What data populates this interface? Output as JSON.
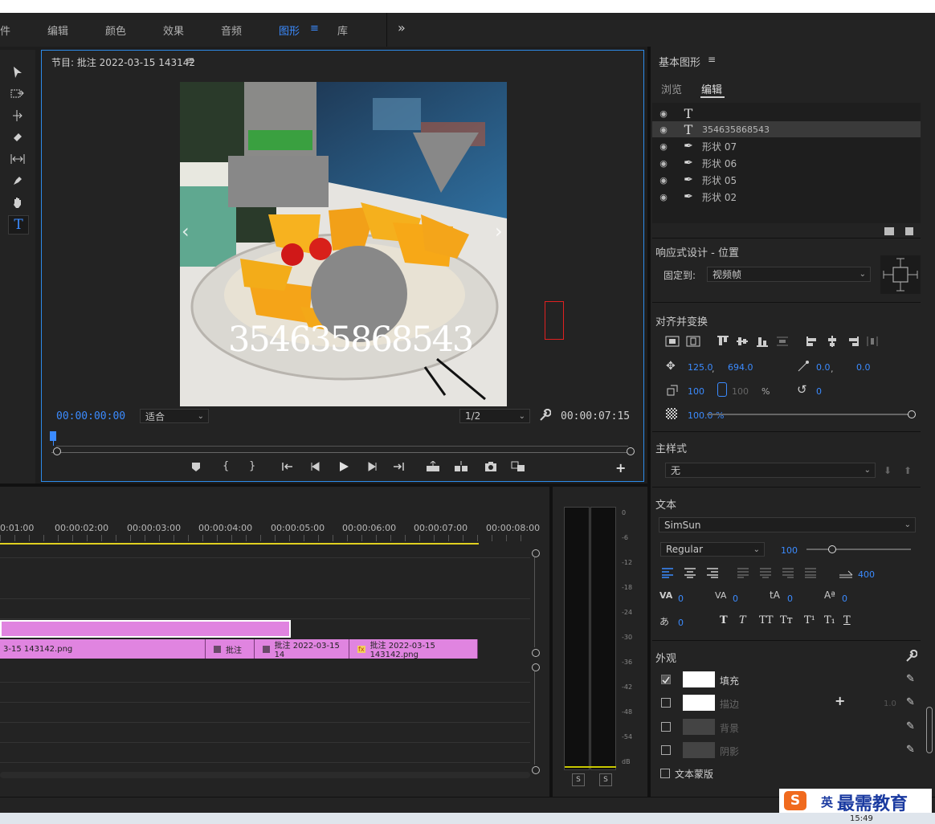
{
  "workspace_tabs": [
    {
      "label": "件"
    },
    {
      "label": "编辑"
    },
    {
      "label": "颜色"
    },
    {
      "label": "效果"
    },
    {
      "label": "音频"
    },
    {
      "label": "图形"
    },
    {
      "label": "库"
    }
  ],
  "workspace_menu_icon": "≡",
  "workspace_more": "»",
  "program_monitor": {
    "title": "节目: 批注 2022-03-15 143142",
    "menu_icon": "≡",
    "overlay_text": "354635868543",
    "timecode_current": "00:00:00:00",
    "zoom_select": "适合",
    "resolution_select": "1/2",
    "timecode_duration": "00:00:07:15",
    "prev_arrow": "‹",
    "next_arrow": "›"
  },
  "timeline": {
    "ruler_labels": [
      "0:01:00",
      "00:00:02:00",
      "00:00:03:00",
      "00:00:04:00",
      "00:00:05:00",
      "00:00:06:00",
      "00:00:07:00",
      "00:00:08:00"
    ],
    "clips": [
      {
        "label": "3-15 143142.png"
      },
      {
        "label": "批注"
      },
      {
        "label": "批注 2022-03-15 14"
      },
      {
        "label": "批注 2022-03-15 143142.png"
      }
    ]
  },
  "audio_meter": {
    "scale": [
      "0",
      "-6",
      "-12",
      "-18",
      "-24",
      "-30",
      "-36",
      "-42",
      "-48",
      "-54",
      "dB"
    ],
    "solo_labels": [
      "S",
      "S"
    ]
  },
  "essential_graphics": {
    "title": "基本图形",
    "menu_icon": "≡",
    "tabs": [
      "浏览",
      "编辑"
    ],
    "layers": [
      {
        "name": "",
        "icon": "T"
      },
      {
        "name": "354635868543",
        "icon": "T"
      },
      {
        "name": "形状 07",
        "icon": "✒"
      },
      {
        "name": "形状 06",
        "icon": "✒"
      },
      {
        "name": "形状 05",
        "icon": "✒"
      },
      {
        "name": "形状 02",
        "icon": "✒"
      }
    ],
    "responsive_title": "响应式设计 - 位置",
    "pin_label": "固定到:",
    "pin_value": "视频帧",
    "align_title": "对齐并变换",
    "position_x": "125.0",
    "position_y": "694.0",
    "anchor_x": "0.0",
    "anchor_y": "0.0",
    "scale": "100",
    "scale_linked": "100",
    "percent": "%",
    "rotation": "0",
    "opacity": "100.0 %",
    "comma": ",",
    "master_style_title": "主样式",
    "master_style_value": "无",
    "text_title": "文本",
    "font": "SimSun",
    "font_style": "Regular",
    "font_size": "100",
    "tab_width": "400",
    "kerning": "0",
    "tracking": "0",
    "leading": "0",
    "baseline": "0",
    "tsume": "0",
    "style_buttons": [
      "T",
      "T",
      "TT",
      "Tт",
      "T¹",
      "T₁",
      "T"
    ],
    "appearance_title": "外观",
    "appearance": [
      {
        "label": "填充",
        "checked": true,
        "color": "#ffffff"
      },
      {
        "label": "描边",
        "checked": false,
        "color": "#ffffff",
        "value": "1.0"
      },
      {
        "label": "背景",
        "checked": false,
        "color": "#444444"
      },
      {
        "label": "阴影",
        "checked": false,
        "color": "#444444"
      }
    ],
    "text_mask": "文本蒙版"
  },
  "watermark": {
    "logo_letter": "S",
    "ime": "英",
    "brand": "最需教育"
  },
  "taskbar_time": "15:49",
  "colors": {
    "accent": "#3b8bff",
    "clip": "#e084e0",
    "playhead_bar": "#e0d020"
  }
}
